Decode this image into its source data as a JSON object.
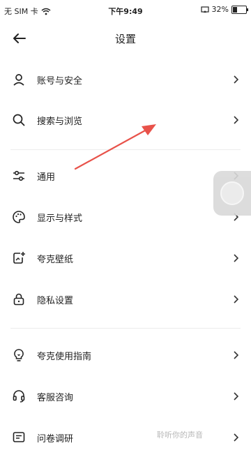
{
  "status_bar": {
    "carrier": "无 SIM 卡",
    "time": "下午9:49",
    "battery_percent_label": "32%",
    "battery_level": 0.32
  },
  "header": {
    "title": "设置",
    "back_icon": "arrow-left-icon"
  },
  "menu": {
    "items": [
      {
        "label": "账号与安全",
        "icon": "user-icon"
      },
      {
        "label": "搜索与浏览",
        "icon": "search-icon"
      },
      {
        "label": "通用",
        "icon": "sliders-icon"
      },
      {
        "label": "显示与样式",
        "icon": "palette-icon"
      },
      {
        "label": "夸克壁纸",
        "icon": "wallpaper-icon"
      },
      {
        "label": "隐私设置",
        "icon": "lock-icon"
      },
      {
        "label": "夸克使用指南",
        "icon": "lightbulb-icon"
      },
      {
        "label": "客服咨询",
        "icon": "headset-icon"
      },
      {
        "label": "问卷调研",
        "icon": "survey-icon"
      }
    ]
  },
  "overlay": {
    "annotation": "red-arrow",
    "arrow_color": "#e8524a",
    "watermark": "聆听你的声音"
  }
}
